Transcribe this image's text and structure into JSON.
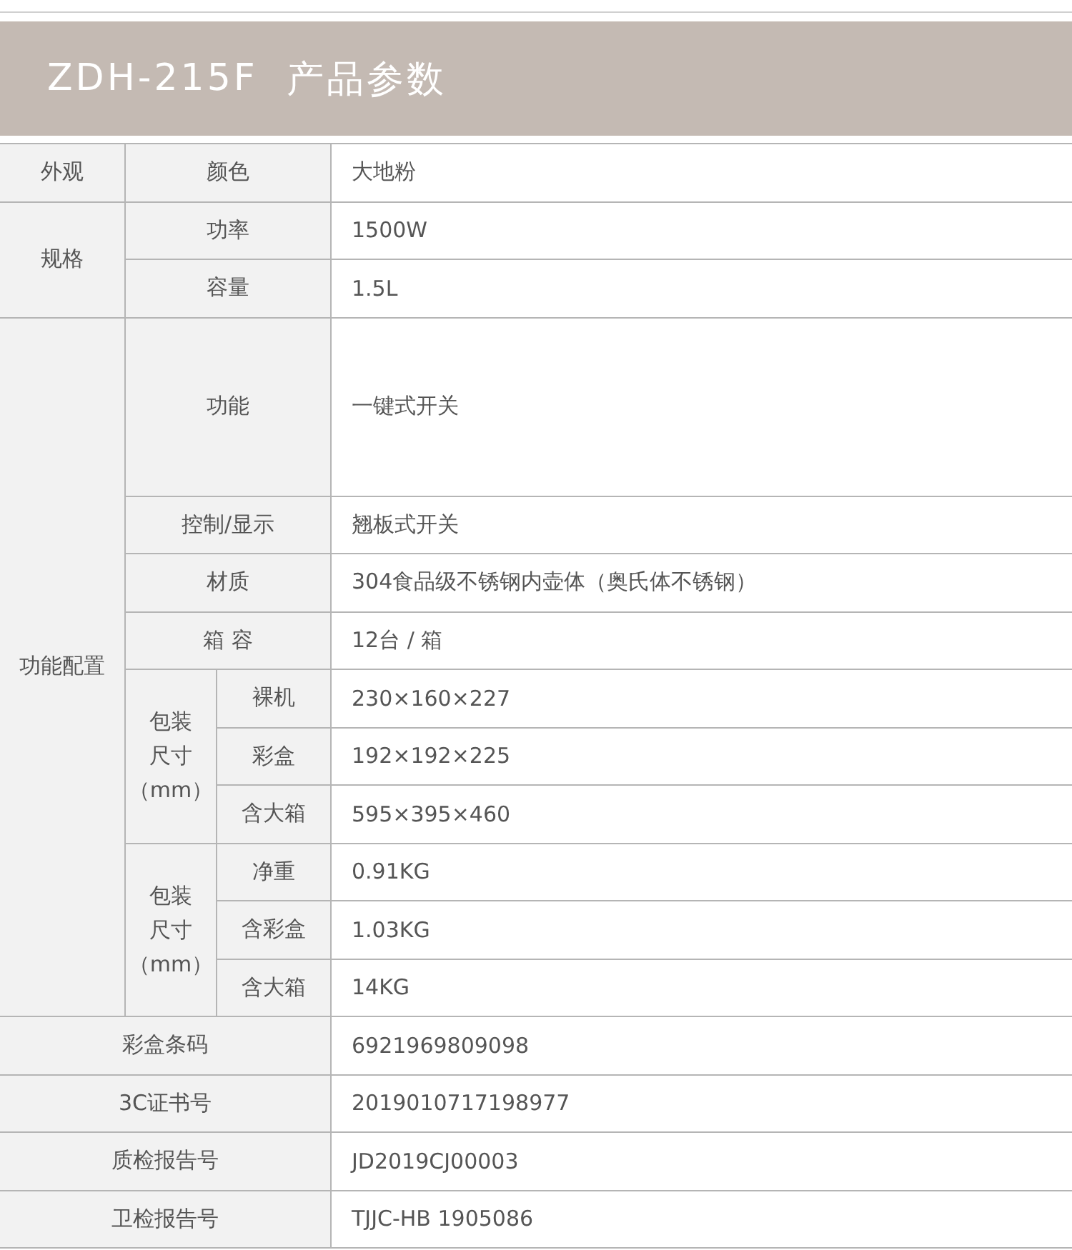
{
  "header": {
    "model": "ZDH-215F",
    "title": "产品参数"
  },
  "sections": [
    {
      "label": "外观",
      "rows": [
        {
          "kind": "row",
          "name": "颜色",
          "value": "大地粉"
        }
      ]
    },
    {
      "label": "规格",
      "rows": [
        {
          "kind": "row",
          "name": "功率",
          "value": "1500W"
        },
        {
          "kind": "row",
          "name": "容量",
          "value": "1.5L"
        }
      ]
    },
    {
      "label": "功能配置",
      "rows": [
        {
          "kind": "tall",
          "name": "功能",
          "value": "一键式开关"
        },
        {
          "kind": "row",
          "name": "控制/显示",
          "value": "翘板式开关"
        },
        {
          "kind": "row",
          "name": "材质",
          "value": "304食品级不锈钢内壶体（奥氏体不锈钢）"
        },
        {
          "kind": "row",
          "name": "箱 容",
          "value": "12台 / 箱"
        },
        {
          "kind": "group",
          "label": "包装尺寸（mm）",
          "rows": [
            {
              "name": "裸机",
              "value": "230×160×227"
            },
            {
              "name": "彩盒",
              "value": "192×192×225"
            },
            {
              "name": "含大箱",
              "value": "595×395×460"
            }
          ]
        },
        {
          "kind": "group",
          "label": "包装尺寸（mm）",
          "rows": [
            {
              "name": "净重",
              "value": "0.91KG"
            },
            {
              "name": "含彩盒",
              "value": "1.03KG"
            },
            {
              "name": "含大箱",
              "value": "14KG"
            }
          ]
        }
      ]
    }
  ],
  "footer_rows": [
    {
      "name": "彩盒条码",
      "value": "6921969809098"
    },
    {
      "name": "3C证书号",
      "value": "2019010717198977"
    },
    {
      "name": "质检报告号",
      "value": "JD2019CJ00003"
    },
    {
      "name": "卫检报告号",
      "value": "TJJC-HB 1905086"
    }
  ]
}
